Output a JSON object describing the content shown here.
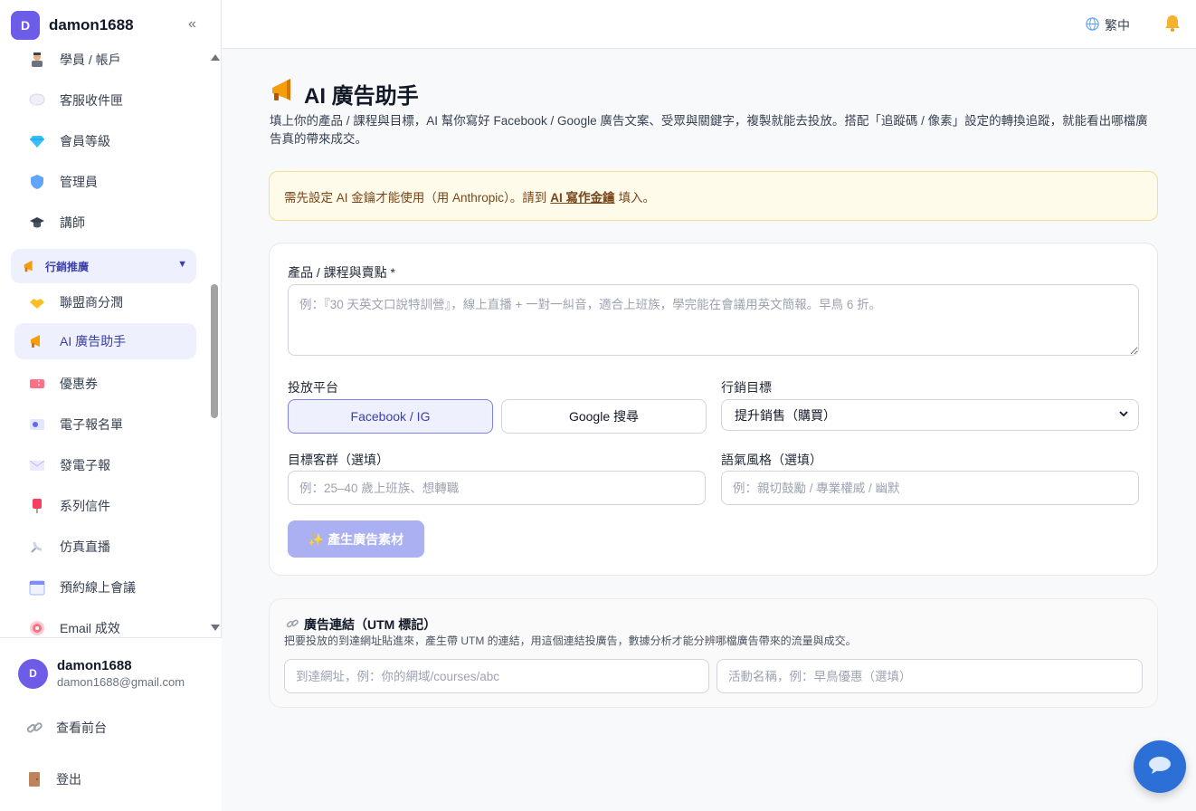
{
  "sidebar": {
    "brand_initial": "D",
    "brand_name": "damon1688",
    "collapse_symbol": "«",
    "items_top": [
      {
        "label": "學員 / 帳戶",
        "icon": "student-icon"
      },
      {
        "label": "客服收件匣",
        "icon": "chat-bubble-icon"
      },
      {
        "label": "會員等級",
        "icon": "diamond-icon"
      },
      {
        "label": "管理員",
        "icon": "shield-icon"
      },
      {
        "label": "講師",
        "icon": "graduation-cap-icon"
      }
    ],
    "section": {
      "label": "行銷推廣",
      "icon": "megaphone-icon",
      "caret": "▼"
    },
    "items_section": [
      {
        "label": "聯盟商分潤",
        "icon": "handshake-icon"
      },
      {
        "label": "AI 廣告助手",
        "icon": "megaphone-icon",
        "active": true
      },
      {
        "label": "優惠券",
        "icon": "ticket-icon"
      },
      {
        "label": "電子報名單",
        "icon": "id-card-icon"
      },
      {
        "label": "發電子報",
        "icon": "envelope-icon"
      },
      {
        "label": "系列信件",
        "icon": "mailbox-icon"
      },
      {
        "label": "仿真直播",
        "icon": "satellite-icon"
      },
      {
        "label": "預約線上會議",
        "icon": "calendar-icon"
      },
      {
        "label": "Email 成效",
        "icon": "target-icon"
      }
    ],
    "footer": {
      "user_initial": "D",
      "user_name": "damon1688",
      "user_email": "damon1688@gmail.com",
      "view_frontend": "查看前台",
      "logout": "登出"
    }
  },
  "topbar": {
    "language": "繁中"
  },
  "main": {
    "title": "AI 廣告助手",
    "description": "填上你的產品 / 課程與目標，AI 幫你寫好 Facebook / Google 廣告文案、受眾與關鍵字，複製就能去投放。搭配「追蹤碼 / 像素」設定的轉換追蹤，就能看出哪檔廣告真的帶來成交。",
    "alert": {
      "prefix": "需先設定 AI 金鑰才能使用（用 Anthropic）。請到",
      "link": "AI 寫作金鑰",
      "suffix": "填入。"
    },
    "form": {
      "product_label": "產品 / 課程與賣點 *",
      "product_placeholder": "例：『30 天英文口說特訓營』，線上直播 + 一對一糾音，適合上班族，學完能在會議用英文簡報。早鳥 6 折。",
      "platform_label": "投放平台",
      "platform_options": [
        "Facebook / IG",
        "Google 搜尋"
      ],
      "platform_selected": "Facebook / IG",
      "goal_label": "行銷目標",
      "goal_value": "提升銷售（購買）",
      "audience_label": "目標客群（選填）",
      "audience_placeholder": "例：25–40 歲上班族、想轉職",
      "tone_label": "語氣風格（選填）",
      "tone_placeholder": "例：親切鼓勵 / 專業權威 / 幽默",
      "generate_button": "✨ 產生廣告素材"
    },
    "utm": {
      "title": "廣告連結（UTM 標記）",
      "description": "把要投放的到達網址貼進來，產生帶 UTM 的連結，用這個連結投廣告，數據分析才能分辨哪檔廣告帶來的流量與成交。",
      "url_placeholder": "到達網址，例：你的網域/courses/abc",
      "campaign_placeholder": "活動名稱，例：早鳥優惠（選填）"
    }
  },
  "colors": {
    "brand": "#6d5ce8",
    "accent_active": "#3b3fa8",
    "alert_bg": "#fefbea",
    "button_disabled": "#aab0f2",
    "chat_fab": "#2c6fd6"
  }
}
